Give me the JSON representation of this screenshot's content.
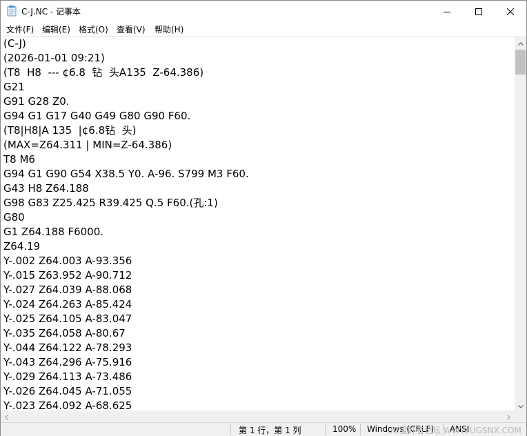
{
  "window": {
    "title": "C-J.NC - 记事本",
    "icon": "notepad-icon",
    "controls": [
      "minimize-icon",
      "maximize-icon",
      "close-icon"
    ]
  },
  "menu": [
    "文件(F)",
    "编辑(E)",
    "格式(O)",
    "查看(V)",
    "帮助(H)"
  ],
  "editor": {
    "lines": [
      "(C-J)",
      "(2026-01-01 09:21)",
      "(T8  H8  --- ¢6.8  钻  头A135  Z-64.386)",
      "G21",
      "G91 G28 Z0.",
      "G94 G1 G17 G40 G49 G80 G90 F60.",
      "(T8|H8|A 135  |¢6.8钻  头)",
      "(MAX=Z64.311 | MIN=Z-64.386)",
      "T8 M6",
      "G94 G1 G90 G54 X38.5 Y0. A-96. S799 M3 F60.",
      "G43 H8 Z64.188",
      "G98 G83 Z25.425 R39.425 Q.5 F60.(孔:1)",
      "G80",
      "G1 Z64.188 F6000.",
      "Z64.19",
      "Y-.002 Z64.003 A-93.356",
      "Y-.015 Z63.952 A-90.712",
      "Y-.027 Z64.039 A-88.068",
      "Y-.024 Z64.263 A-85.424",
      "Y-.025 Z64.105 A-83.047",
      "Y-.035 Z64.058 A-80.67",
      "Y-.044 Z64.122 A-78.293",
      "Y-.043 Z64.296 A-75.916",
      "Y-.029 Z64.113 A-73.486",
      "Y-.026 Z64.045 A-71.055",
      "Y-.023 Z64.092 A-68.625"
    ]
  },
  "status": {
    "position": "第 1 行，第 1 列",
    "zoom": "100%",
    "line_ending": "Windows (CRLF)",
    "encoding": "ANSI",
    "watermark": "UG爱好者论坛 WWW.UGSNX.COM"
  }
}
